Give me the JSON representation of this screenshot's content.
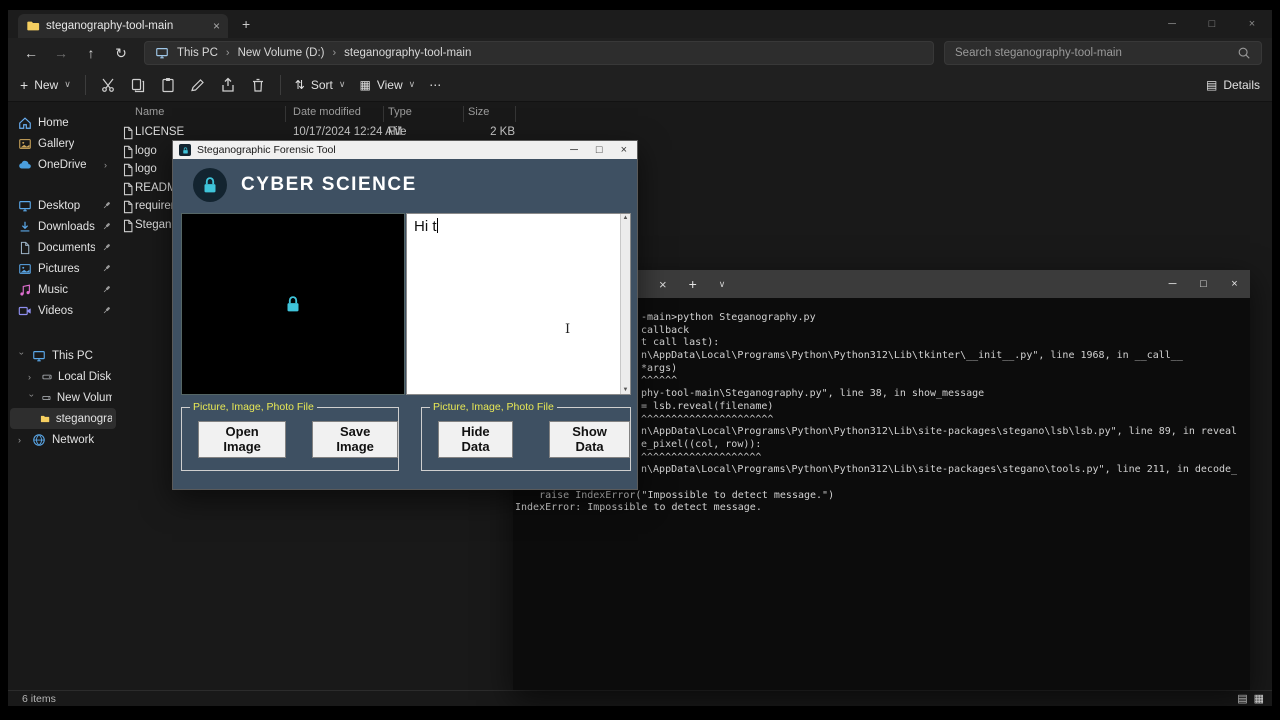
{
  "colors": {
    "brand_cyan": "#3fc4da",
    "header_slate": "#3e5062",
    "group_label_yellow": "#e8e855"
  },
  "explorer": {
    "tab_bar": {
      "tab_title": "steganography-tool-main"
    },
    "nav": {
      "breadcrumb": {
        "item1": "This PC",
        "item2": "New Volume (D:)",
        "item3": "steganography-tool-main"
      },
      "search_placeholder": "Search steganography-tool-main"
    },
    "command_bar": {
      "new": "New",
      "sort": "Sort",
      "view": "View",
      "details": "Details"
    },
    "columns": {
      "name": "Name",
      "date": "Date modified",
      "type": "Type",
      "size": "Size"
    },
    "files": [
      {
        "name": "LICENSE",
        "date": "10/17/2024 12:24 AM",
        "type": "File",
        "size": "2 KB"
      },
      {
        "name": "logo"
      },
      {
        "name": "logo"
      },
      {
        "name": "README.m"
      },
      {
        "name": "requiremen"
      },
      {
        "name": "Steganogra"
      }
    ],
    "sidebar": {
      "items": [
        {
          "label": "Home"
        },
        {
          "label": "Gallery"
        },
        {
          "label": "OneDrive"
        },
        {
          "label": "Desktop"
        },
        {
          "label": "Downloads"
        },
        {
          "label": "Documents"
        },
        {
          "label": "Pictures"
        },
        {
          "label": "Music"
        },
        {
          "label": "Videos"
        },
        {
          "label": "This PC"
        },
        {
          "label": "Local Disk (C:)"
        },
        {
          "label": "New Volume (D:)"
        },
        {
          "label": "steganography-"
        },
        {
          "label": "Network"
        }
      ]
    },
    "status_bar": {
      "items_count": "6 items"
    }
  },
  "dialog": {
    "title": "Steganographic Forensic Tool",
    "brand": "CYBER SCIENCE",
    "message_text": "Hi t",
    "groups": [
      {
        "label": "Picture, Image, Photo File",
        "buttons": [
          "Open Image",
          "Save Image"
        ]
      },
      {
        "label": "Picture, Image, Photo File",
        "buttons": [
          "Hide Data",
          "Show Data"
        ]
      }
    ]
  },
  "terminal": {
    "lines": [
      "-main>python Steganography.py",
      "callback",
      "t call last):",
      "n\\AppData\\Local\\Programs\\Python\\Python312\\Lib\\tkinter\\__init__.py\", line 1968, in __call__",
      "*args)",
      "^^^^^^",
      "phy-tool-main\\Steganography.py\", line 38, in show_message",
      "= lsb.reveal(filename)",
      "^^^^^^^^^^^^^^^^^^^^^^",
      "n\\AppData\\Local\\Programs\\Python\\Python312\\Lib\\site-packages\\stegano\\lsb\\lsb.py\", line 89, in reveal",
      "e_pixel((col, row)):",
      "^^^^^^^^^^^^^^^^^^^^",
      "n\\AppData\\Local\\Programs\\Python\\Python312\\Lib\\site-packages\\stegano\\tools.py\", line 211, in decode_",
      "",
      "    raise IndexError(\"Impossible to detect message.\")",
      "IndexError: Impossible to detect message."
    ]
  }
}
